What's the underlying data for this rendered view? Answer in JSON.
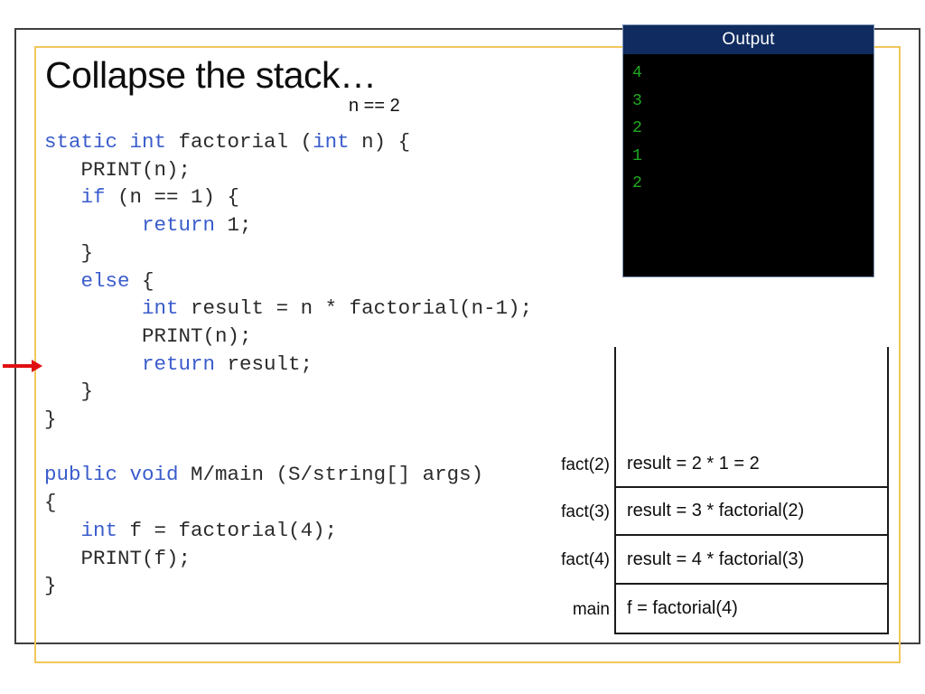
{
  "slide": {
    "title": "Collapse the stack…",
    "annotation": "n == 2"
  },
  "code": {
    "lines": [
      [
        {
          "t": "static int",
          "k": true
        },
        {
          "t": " factorial (",
          "k": false
        },
        {
          "t": "int",
          "k": true
        },
        {
          "t": " n) {",
          "k": false
        }
      ],
      [
        {
          "t": "   PRINT(n);",
          "k": false
        }
      ],
      [
        {
          "t": "   ",
          "k": false
        },
        {
          "t": "if",
          "k": true
        },
        {
          "t": " (n == 1) {",
          "k": false
        }
      ],
      [
        {
          "t": "        ",
          "k": false
        },
        {
          "t": "return",
          "k": true
        },
        {
          "t": " 1;",
          "k": false
        }
      ],
      [
        {
          "t": "   }",
          "k": false
        }
      ],
      [
        {
          "t": "   ",
          "k": false
        },
        {
          "t": "else",
          "k": true
        },
        {
          "t": " {",
          "k": false
        }
      ],
      [
        {
          "t": "        ",
          "k": false
        },
        {
          "t": "int",
          "k": true
        },
        {
          "t": " result = n * factorial(n-1);",
          "k": false
        }
      ],
      [
        {
          "t": "        PRINT(n);",
          "k": false
        }
      ],
      [
        {
          "t": "        ",
          "k": false
        },
        {
          "t": "return",
          "k": true
        },
        {
          "t": " result;",
          "k": false
        }
      ],
      [
        {
          "t": "   }",
          "k": false
        }
      ],
      [
        {
          "t": "}",
          "k": false
        }
      ],
      [],
      [
        {
          "t": "public void",
          "k": true
        },
        {
          "t": " M/main (S/string[] args)",
          "k": false
        }
      ],
      [
        {
          "t": "{",
          "k": false
        }
      ],
      [
        {
          "t": "   ",
          "k": false
        },
        {
          "t": "int",
          "k": true
        },
        {
          "t": " f = factorial(4);",
          "k": false
        }
      ],
      [
        {
          "t": "   PRINT(f);",
          "k": false
        }
      ],
      [
        {
          "t": "}",
          "k": false
        }
      ]
    ],
    "keyword_color": "#3a5ccc",
    "text_color": "#2b2b2b"
  },
  "arrow": {
    "name": "current-line-arrow",
    "color": "#e01010"
  },
  "output": {
    "title": "Output",
    "lines": [
      "4",
      "3",
      "2",
      "1",
      "2"
    ],
    "titlebar_color": "#0f2b5f",
    "background_color": "#000000",
    "text_color": "#1faa1f"
  },
  "call_stack": {
    "frames": [
      {
        "label": "",
        "content": "",
        "empty": true
      },
      {
        "label": "fact(2)",
        "content": "result = 2 * 1 = 2",
        "empty": false
      },
      {
        "label": "fact(3)",
        "content": "result = 3 * factorial(2)",
        "empty": false
      },
      {
        "label": "fact(4)",
        "content": "result = 4 * factorial(3)",
        "empty": false
      },
      {
        "label": "main",
        "content": "f = factorial(4)",
        "empty": false
      }
    ]
  },
  "frames": {
    "outer_border_color": "#3f3f3f",
    "inner_border_color": "#f2c75c"
  }
}
